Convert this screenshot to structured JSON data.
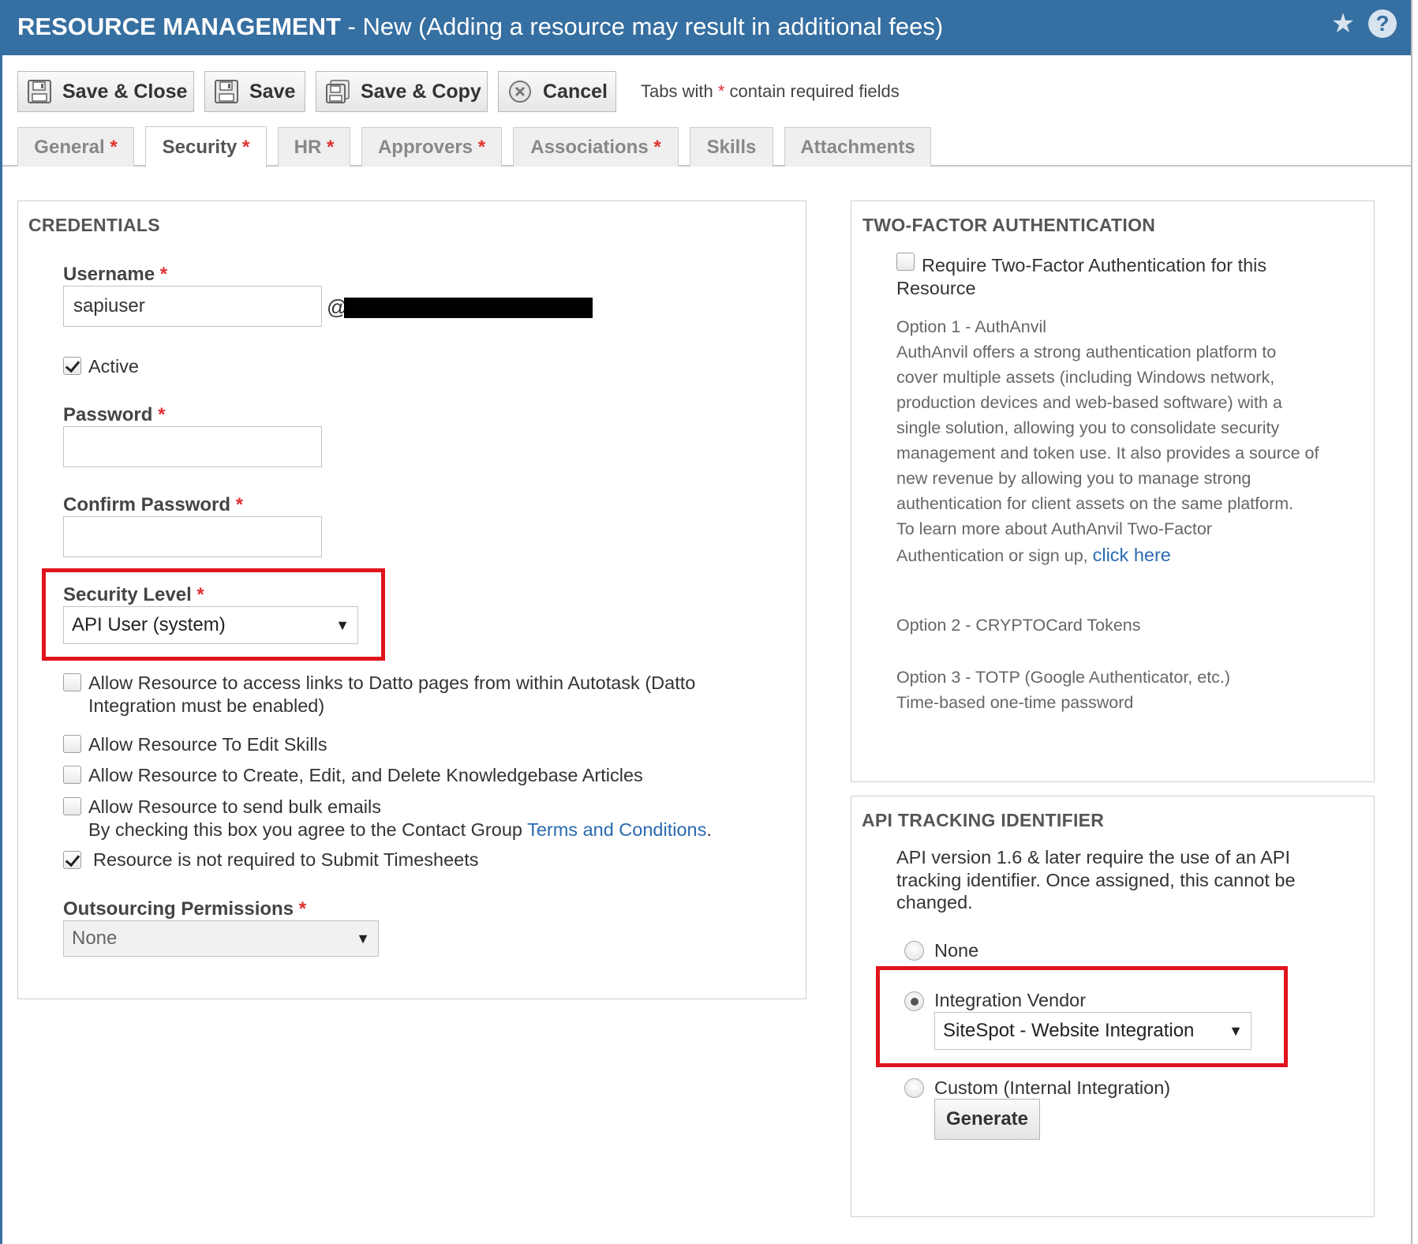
{
  "window": {
    "title_bold": "RESOURCE MANAGEMENT",
    "title_rest": " - New (Adding a resource may result in additional fees)",
    "star_glyph": "★",
    "help_glyph": "?"
  },
  "toolbar": {
    "save_close": "Save & Close",
    "save": "Save",
    "save_copy": "Save & Copy",
    "cancel": "Cancel",
    "req_note_pre": "Tabs with ",
    "req_note_star": "*",
    "req_note_post": " contain required fields"
  },
  "tabs": [
    {
      "label": "General",
      "required": "*"
    },
    {
      "label": "Security",
      "required": "*"
    },
    {
      "label": "HR",
      "required": "*"
    },
    {
      "label": "Approvers",
      "required": "*"
    },
    {
      "label": "Associations",
      "required": "*"
    },
    {
      "label": "Skills",
      "required": ""
    },
    {
      "label": "Attachments",
      "required": ""
    }
  ],
  "credentials": {
    "heading": "CREDENTIALS",
    "username_label": "Username",
    "username_value": "sapiuser",
    "at_sign": "@",
    "active_label": "Active",
    "password_label": "Password",
    "confirm_label": "Confirm Password",
    "security_level_label": "Security Level",
    "security_level_value": "API User (system)",
    "req_star": "*",
    "opt_datto_1": "Allow Resource to access links to Datto pages from within Autotask (Datto",
    "opt_datto_2": "Integration must be enabled)",
    "opt_skills": "Allow Resource To Edit Skills",
    "opt_kb": "Allow Resource to Create, Edit, and Delete Knowledgebase Articles",
    "opt_bulk": "Allow Resource to send bulk emails",
    "opt_bulk_note_pre": "By checking this box you agree to the Contact Group ",
    "opt_bulk_note_link": "Terms and Conditions",
    "opt_bulk_note_post": ".",
    "opt_timesheets": "Resource is not required to Submit Timesheets",
    "outsourcing_label": "Outsourcing Permissions",
    "outsourcing_value": "None",
    "caret": "▼"
  },
  "two_factor": {
    "heading": "TWO-FACTOR AUTHENTICATION",
    "require_1": "Require Two-Factor Authentication for this",
    "require_2": "Resource",
    "opt1_title": "Option 1 - AuthAnvil",
    "opt1_lines": [
      "AuthAnvil offers a strong authentication platform to",
      "cover multiple assets (including Windows network,",
      "production devices and web-based software) with a",
      "single solution, allowing you to consolidate security",
      "management and token use. It also provides a source of",
      "new revenue by allowing you to manage strong",
      "authentication for client assets on the same platform.",
      "To learn more about AuthAnvil Two-Factor"
    ],
    "opt1_last_pre": "Authentication or sign up, ",
    "opt1_link": "click here",
    "opt2": "Option 2 - CRYPTOCard Tokens",
    "opt3_title": "Option 3 - TOTP (Google Authenticator, etc.)",
    "opt3_desc": "Time-based one-time password"
  },
  "api_tracking": {
    "heading": "API TRACKING IDENTIFIER",
    "desc_1": "API version 1.6 & later require the use of an API",
    "desc_2": "tracking identifier. Once assigned, this cannot be",
    "desc_3": "changed.",
    "opt_none": "None",
    "opt_vendor": "Integration Vendor",
    "vendor_value": "SiteSpot - Website Integration",
    "opt_custom": "Custom (Internal Integration)",
    "generate": "Generate",
    "selected": "Integration Vendor"
  },
  "colors": {
    "titlebar": "#366fa1",
    "highlight_box": "#e0141c",
    "link": "#2a6ab0",
    "required_star": "#e03030"
  }
}
